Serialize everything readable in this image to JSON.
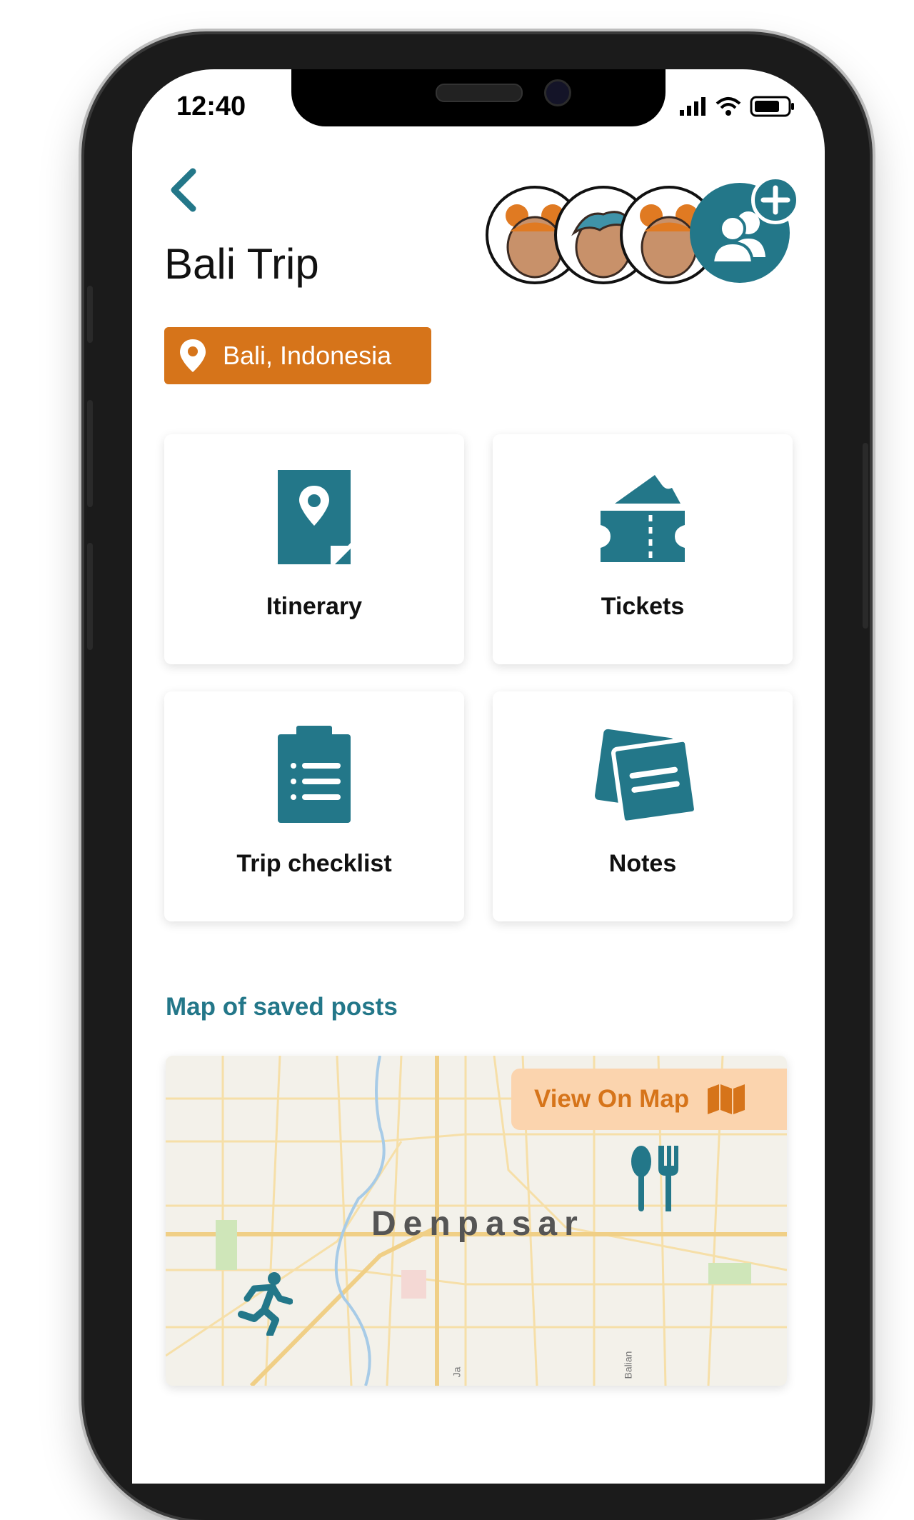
{
  "status_bar": {
    "time": "12:40"
  },
  "header": {
    "title": "Bali Trip"
  },
  "location": {
    "label": "Bali, Indonesia"
  },
  "tiles": [
    {
      "label": "Itinerary",
      "icon": "itinerary-pin-document-icon"
    },
    {
      "label": "Tickets",
      "icon": "ticket-icon"
    },
    {
      "label": "Trip checklist",
      "icon": "clipboard-checklist-icon"
    },
    {
      "label": "Notes",
      "icon": "notes-icon"
    }
  ],
  "map_section": {
    "title": "Map of saved posts",
    "view_button": "View On Map",
    "city_label": "Denpasar",
    "street_labels": [
      "Ja",
      "Balian"
    ]
  },
  "colors": {
    "accent": "#237789",
    "orange": "#d6741a",
    "orange_light": "#fbd4ae"
  }
}
